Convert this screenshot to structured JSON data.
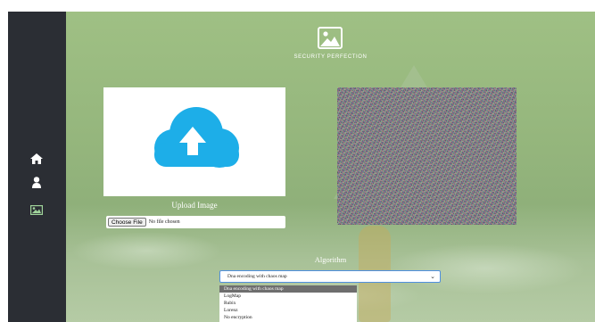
{
  "header": {
    "title": "SECURITY PERFECTION",
    "icon": "image-icon"
  },
  "sidebar": {
    "background": "#2b2e34",
    "items": [
      {
        "name": "home",
        "icon": "home-icon"
      },
      {
        "name": "user",
        "icon": "user-icon"
      },
      {
        "name": "image",
        "icon": "image-icon",
        "active": true
      }
    ]
  },
  "upload": {
    "label": "Upload Image",
    "icon": "cloud-upload-icon",
    "accent": "#1daee8",
    "file_button": "Choose File",
    "file_status": "No file chosen"
  },
  "result": {
    "content": "noise-encrypted-image"
  },
  "algorithm": {
    "label": "Algorithm",
    "selected": "Dna encoding with chaos map",
    "options": [
      "Dna encoding with chaos map",
      "LogMap",
      "Rubix",
      "Lorenz",
      "No encryption"
    ]
  }
}
